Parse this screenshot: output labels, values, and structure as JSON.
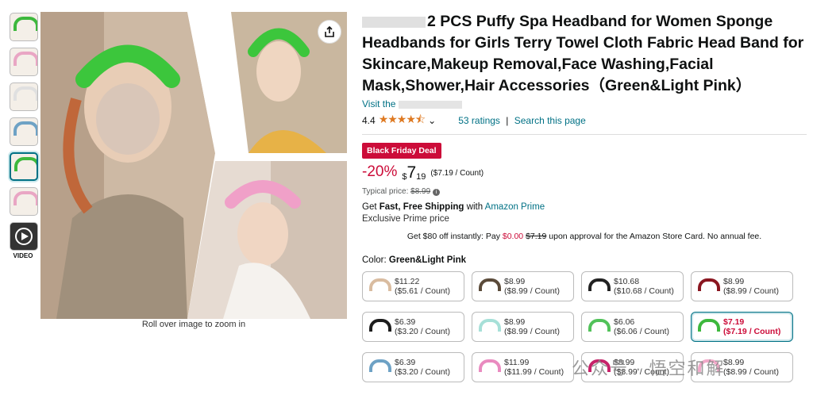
{
  "thumbnails": [
    {
      "color": "#3db83d"
    },
    {
      "color": "#e9a6c4"
    },
    {
      "color": "#e0e0e0"
    },
    {
      "color": "#6ea2c5"
    },
    {
      "color": "#3db83d"
    },
    {
      "color": "#e9a6c4"
    }
  ],
  "video_label": "VIDEO",
  "zoom_text": "Roll over image to zoom in",
  "product": {
    "title": "2 PCS Puffy Spa Headband for Women Sponge Headbands for Girls Terry Towel Cloth Fabric Head Band for Skincare,Makeup Removal,Face Washing,Facial Mask,Shower,Hair Accessories（Green&Light Pink）",
    "visit": "Visit the",
    "rating": "4.4",
    "stars": "★★★★⯪",
    "ratings_link": "53 ratings",
    "search_link": "Search this page",
    "deal_badge": "Black Friday Deal",
    "discount": "-20%",
    "price_symbol": "$",
    "price_whole": "7",
    "price_fraction": "19",
    "price_per": "($7.19 / Count)",
    "typical_label": "Typical price:",
    "typical_price": "$8.99",
    "ship_get": "Get ",
    "ship_bold": "Fast, Free Shipping",
    "ship_with": " with ",
    "ship_prime": "Amazon Prime",
    "exclusive": "Exclusive Prime price",
    "card_pre": "Get $80 off instantly: Pay ",
    "card_zero": "$0.00",
    "card_strike": "$7.19",
    "card_post": " upon approval for the Amazon Store Card. No annual fee.",
    "color_label": "Color: ",
    "color_value": "Green&Light Pink"
  },
  "options": [
    {
      "price": "$11.22",
      "per": "($5.61 / Count)",
      "color": "#d9bca0"
    },
    {
      "price": "$8.99",
      "per": "($8.99 / Count)",
      "color": "#5b4b3a"
    },
    {
      "price": "$10.68",
      "per": "($10.68 / Count)",
      "color": "#222222"
    },
    {
      "price": "$8.99",
      "per": "($8.99 / Count)",
      "color": "#8a1620"
    },
    {
      "price": "$6.39",
      "per": "($3.20 / Count)",
      "color": "#1d1d1d"
    },
    {
      "price": "$8.99",
      "per": "($8.99 / Count)",
      "color": "#a7e0d8"
    },
    {
      "price": "$6.06",
      "per": "($6.06 / Count)",
      "color": "#52c25a"
    },
    {
      "price": "$7.19",
      "per": "($7.19 / Count)",
      "color": "#3db83d",
      "selected": true
    },
    {
      "price": "$6.39",
      "per": "($3.20 / Count)",
      "color": "#6ea2c5"
    },
    {
      "price": "$11.99",
      "per": "($11.99 / Count)",
      "color": "#e98bc0"
    },
    {
      "price": "$8.99",
      "per": "($8.99 / Count)",
      "color": "#c7226a"
    },
    {
      "price": "$8.99",
      "per": "($8.99 / Count)",
      "color": "#f2a9c9"
    }
  ],
  "watermark": "公众号 · 悟空和解"
}
